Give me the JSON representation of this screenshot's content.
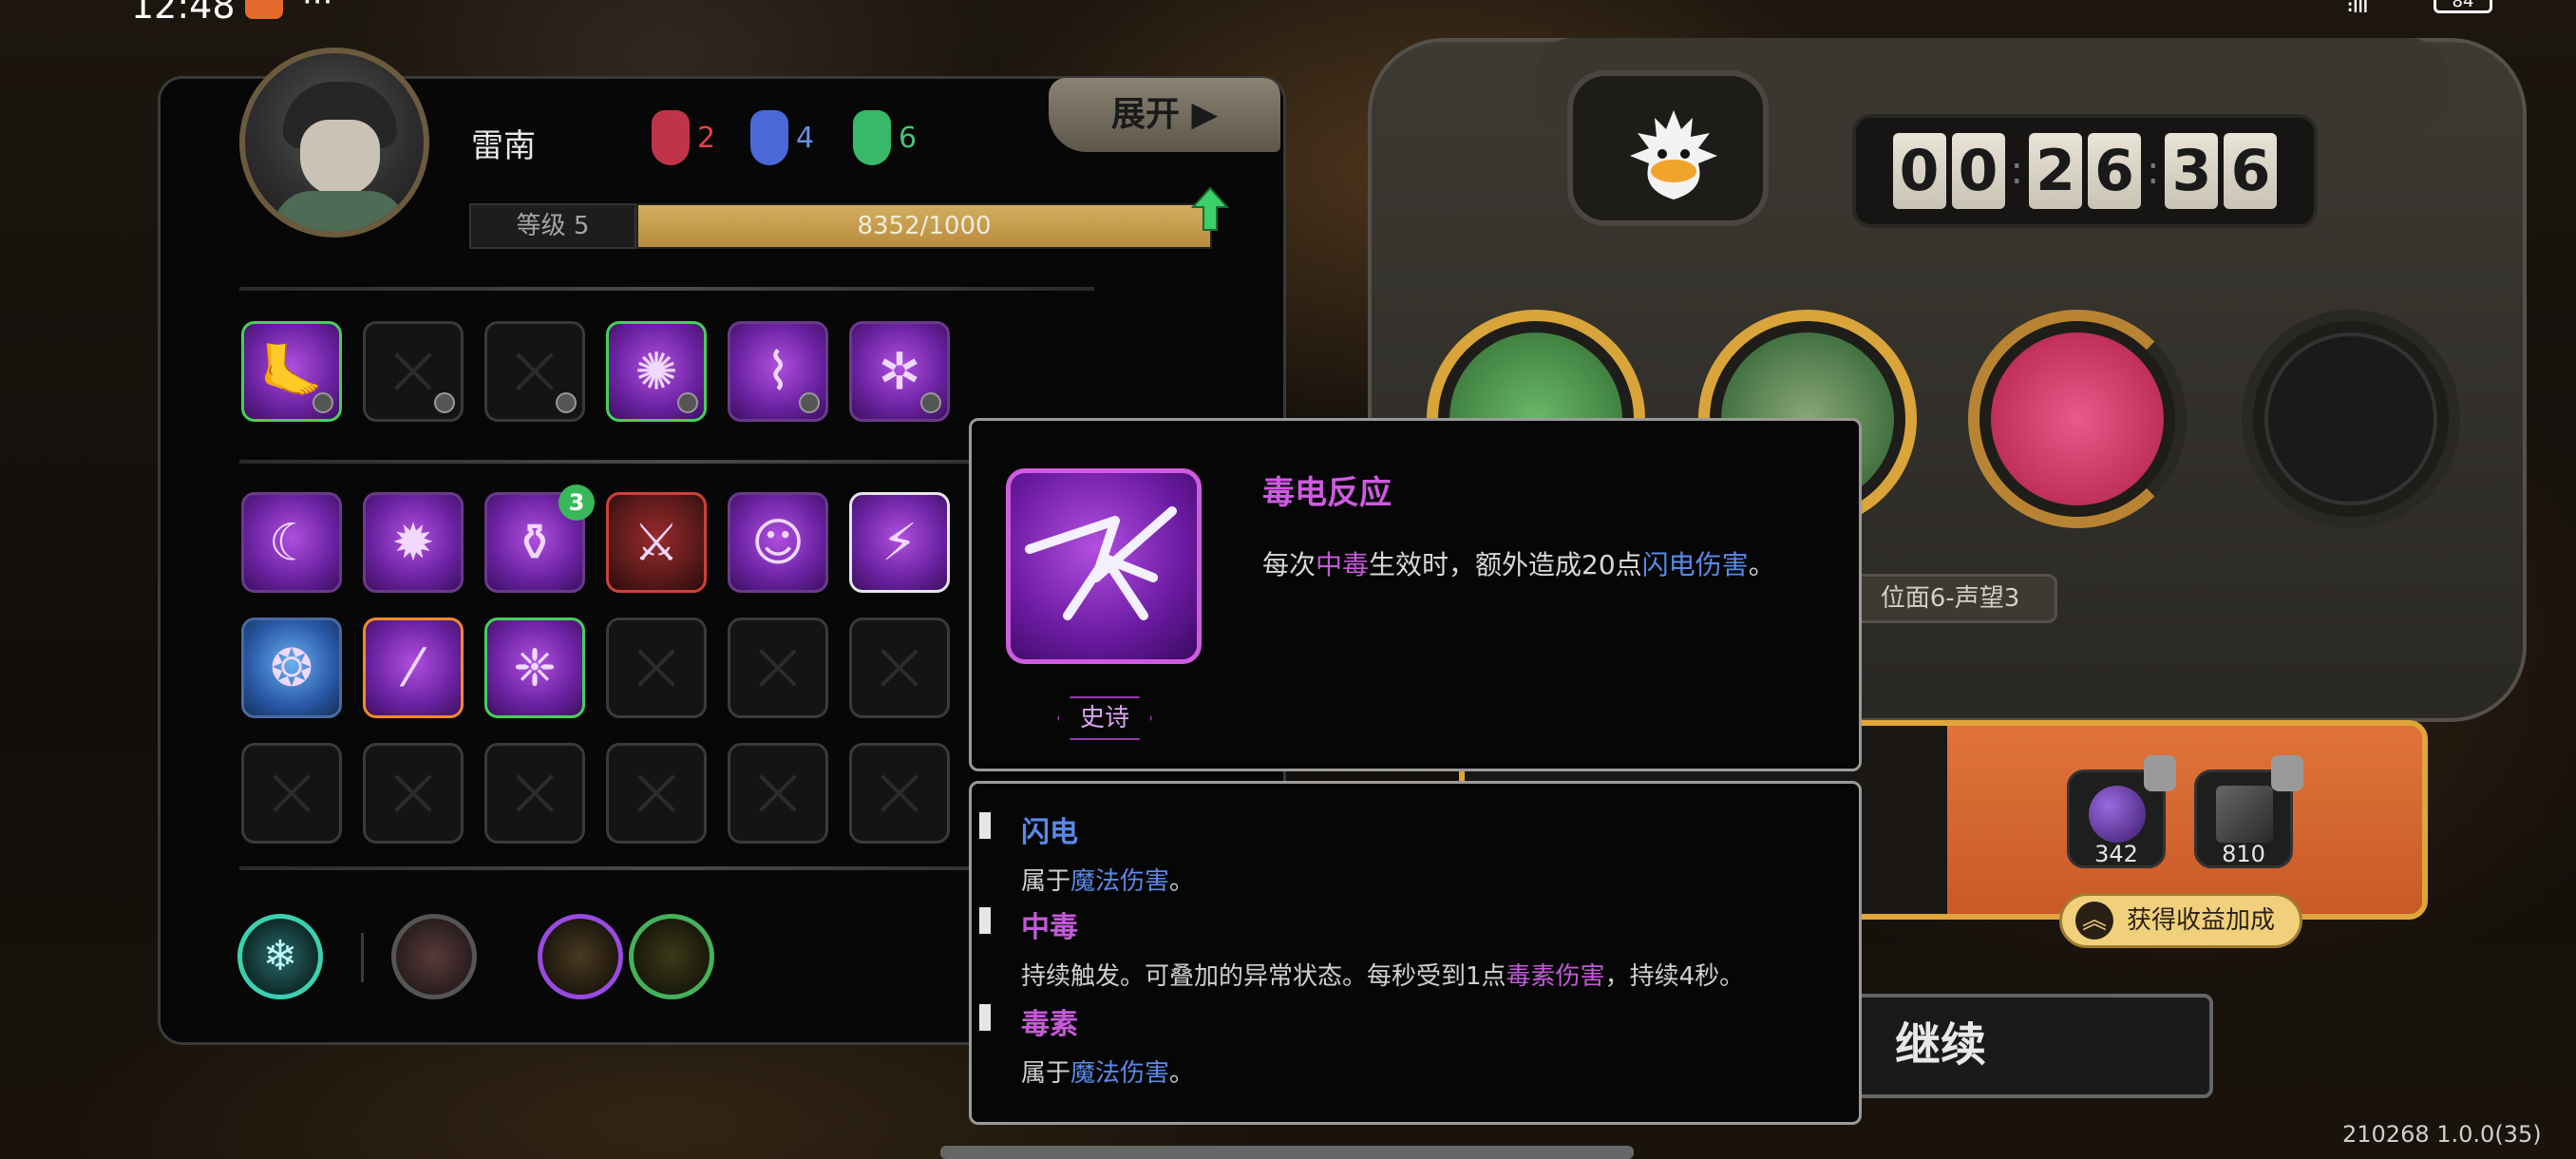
{
  "status": {
    "time": "12:48",
    "battery": "84"
  },
  "character": {
    "name": "雷南",
    "badges": [
      {
        "color": "red",
        "count": "2"
      },
      {
        "color": "blue",
        "count": "4"
      },
      {
        "color": "green",
        "count": "6"
      }
    ],
    "level_label": "等级 5",
    "xp_text": "8352/1000",
    "expand_label": "展开 ▶"
  },
  "equipment_slots": [
    "green-frame",
    "empty",
    "empty",
    "green-frame",
    "purple",
    "purple"
  ],
  "skill_slots": {
    "row1": [
      "purple",
      "purple",
      "purple",
      "red",
      "purple",
      "purple"
    ],
    "row2": [
      "blue",
      "orange",
      "green-frame",
      "empty",
      "empty",
      "empty"
    ],
    "row3": [
      "empty",
      "empty",
      "empty",
      "empty",
      "empty",
      "empty"
    ],
    "stack_count": "3"
  },
  "timer": {
    "digits": [
      "0",
      "0",
      "2",
      "6",
      "3",
      "6"
    ]
  },
  "position_label": "位面6-声望3",
  "rewards": {
    "items": [
      {
        "count": "342"
      },
      {
        "count": "810"
      }
    ],
    "bonus_label": "获得收益加成",
    "continue_label": "继续"
  },
  "tooltip": {
    "title": "毒电反应",
    "rarity": "史诗",
    "desc_prefix": "每次",
    "desc_kw1": "中毒",
    "desc_mid": "生效时，额外造成20点",
    "desc_kw2": "闪电伤害",
    "desc_suffix": "。"
  },
  "keywords": [
    {
      "name": "闪电",
      "color": "#5a8ae8",
      "text_prefix": "属于",
      "text_kw": "魔法伤害",
      "text_suffix": "。"
    },
    {
      "name": "中毒",
      "color": "#c45ad8",
      "text_prefix": "持续触发。可叠加的异常状态。每秒受到1点",
      "text_kw": "毒素伤害",
      "text_suffix": "，持续4秒。"
    },
    {
      "name": "毒素",
      "color": "#c45ad8",
      "text_prefix": "属于",
      "text_kw": "魔法伤害",
      "text_suffix": "。"
    }
  ],
  "version": "210268 1.0.0(35)"
}
